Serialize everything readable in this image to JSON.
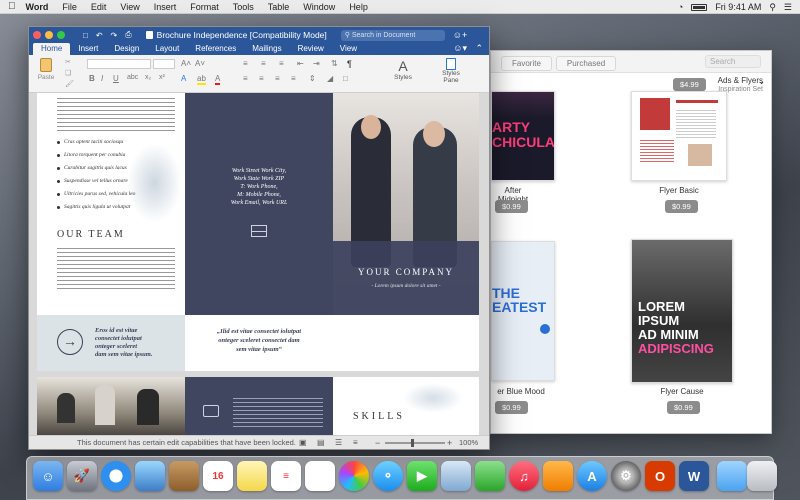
{
  "menubar": {
    "app": "Word",
    "items": [
      "File",
      "Edit",
      "View",
      "Insert",
      "Format",
      "Tools",
      "Table",
      "Window",
      "Help"
    ],
    "clock": "Fri 9:41 AM"
  },
  "store": {
    "tabs": [
      "Favorite",
      "Purchased"
    ],
    "search_placeholder": "Search",
    "category": {
      "title": "Ads & Flyers",
      "subtitle": "Inspiration Set"
    },
    "top_price": "$4.99",
    "items": [
      {
        "caption": "After Midnight",
        "price": "$0.99",
        "art": "ARTY\nCHICULA"
      },
      {
        "caption": "Flyer Basic",
        "price": "$0.99"
      },
      {
        "caption": "er Blue Mood",
        "price": "$0.99",
        "art": "THE\nEATEST"
      },
      {
        "caption": "Flyer Cause",
        "price": "$0.99",
        "art": [
          "LOREM",
          "IPSUM",
          "AD MINIM",
          "ADIPISCING"
        ]
      }
    ]
  },
  "word": {
    "title": "Brochure Independence [Compatibility Mode]",
    "search_placeholder": "Search in Document",
    "tabs": [
      "Home",
      "Insert",
      "Design",
      "Layout",
      "References",
      "Mailings",
      "Review",
      "View"
    ],
    "ribbon": {
      "paste": "Paste",
      "styles": "Styles",
      "styles_pane": "Styles\nPane"
    },
    "status_text": "This document has certain edit capabilities that have been locked.",
    "zoom": "100%"
  },
  "brochure": {
    "bullets": [
      "Cras aptent taciti sociosqu",
      "Litora torquent per conubia",
      "Curabitur sagittis quis lacus",
      "Suspendisse vel tellus ornare",
      "Ultricies purus sed, vehicula leo",
      "Sagittis quis ligula ut volutpat"
    ],
    "our_team": "OUR TEAM",
    "contact": [
      "Work Street Work City,",
      "Work State Work ZIP",
      "T: Work Phone,",
      "M: Mobile Phone,",
      "Work Email, Work URL"
    ],
    "company": "YOUR COMPANY",
    "tagline": "- Lorem ipsum dolore sit amet -",
    "arrow_quote": [
      "Eros id est vitae",
      "consectet iolutpat",
      "onteger sceleret",
      "dam sem vitae ipsum."
    ],
    "quote": [
      "„Ilid est vitae consectet iolutpat",
      "onteger sceleret consectet dam",
      "sem vitae ipsum“"
    ],
    "skills": "SKILLS"
  }
}
